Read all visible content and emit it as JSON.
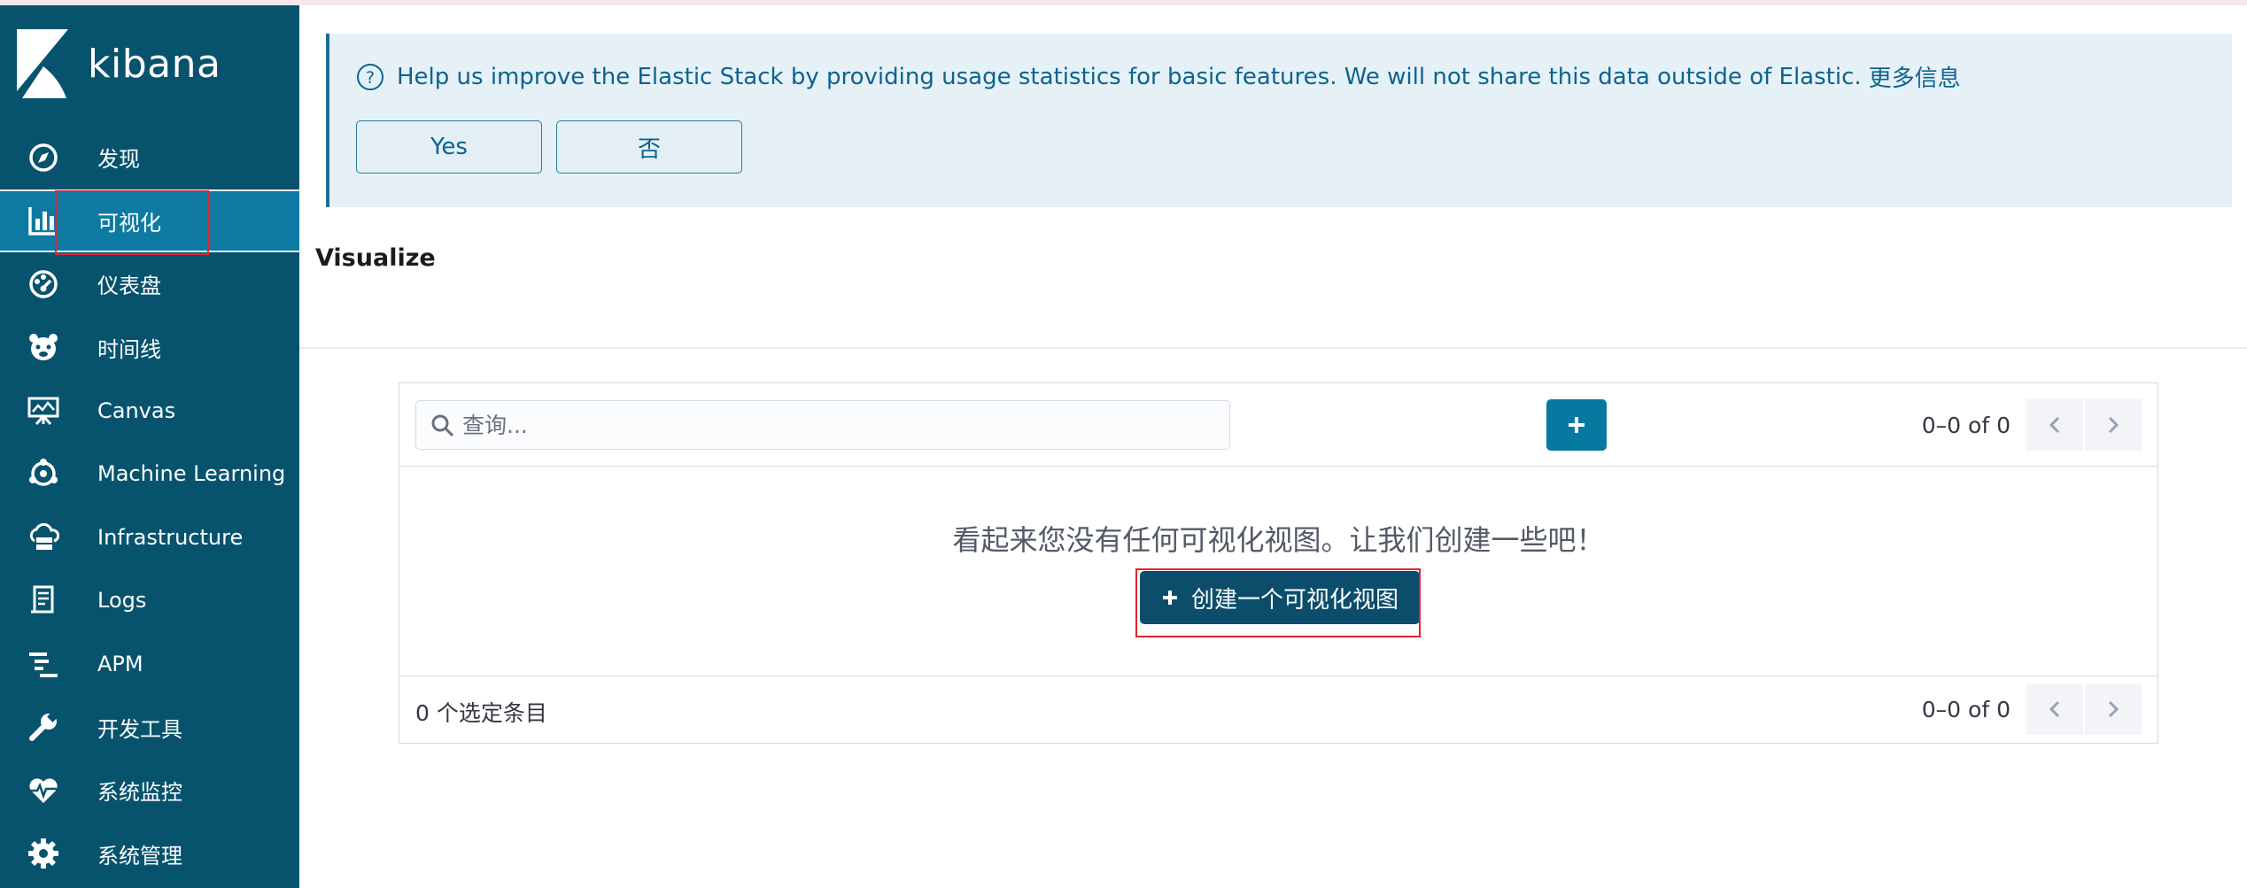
{
  "app": {
    "logo_text": "kibana"
  },
  "sidebar": {
    "items": [
      {
        "label": "发现",
        "icon": "compass-icon"
      },
      {
        "label": "可视化",
        "icon": "bar-chart-icon",
        "active": true
      },
      {
        "label": "仪表盘",
        "icon": "dashboard-gauge-icon"
      },
      {
        "label": "时间线",
        "icon": "timeline-bear-icon"
      },
      {
        "label": "Canvas",
        "icon": "canvas-easel-icon"
      },
      {
        "label": "Machine Learning",
        "icon": "machine-learning-icon"
      },
      {
        "label": "Infrastructure",
        "icon": "infrastructure-cloud-icon"
      },
      {
        "label": "Logs",
        "icon": "logs-icon"
      },
      {
        "label": "APM",
        "icon": "apm-icon"
      },
      {
        "label": "开发工具",
        "icon": "wrench-icon"
      },
      {
        "label": "系统监控",
        "icon": "heartbeat-icon"
      },
      {
        "label": "系统管理",
        "icon": "gear-icon"
      }
    ]
  },
  "banner": {
    "message": "Help us improve the Elastic Stack by providing usage statistics for basic features. We will not share this data outside of Elastic.",
    "link": "更多信息",
    "yes_label": "Yes",
    "no_label": "否"
  },
  "page": {
    "title": "Visualize"
  },
  "list": {
    "search_placeholder": "查询...",
    "pager_top": "0–0 of 0",
    "empty_message": "看起来您没有任何可视化视图。让我们创建一些吧！",
    "create_button": "创建一个可视化视图",
    "selected_count": "0 个选定条目",
    "pager_bottom": "0–0 of 0"
  },
  "colors": {
    "sidebar_bg": "#07536e",
    "sidebar_active": "#0e7aa2",
    "banner_bg": "#e6f1f7",
    "primary": "#0779a1",
    "create_button": "#0c4d6c",
    "highlight_outline": "#e0242e"
  }
}
